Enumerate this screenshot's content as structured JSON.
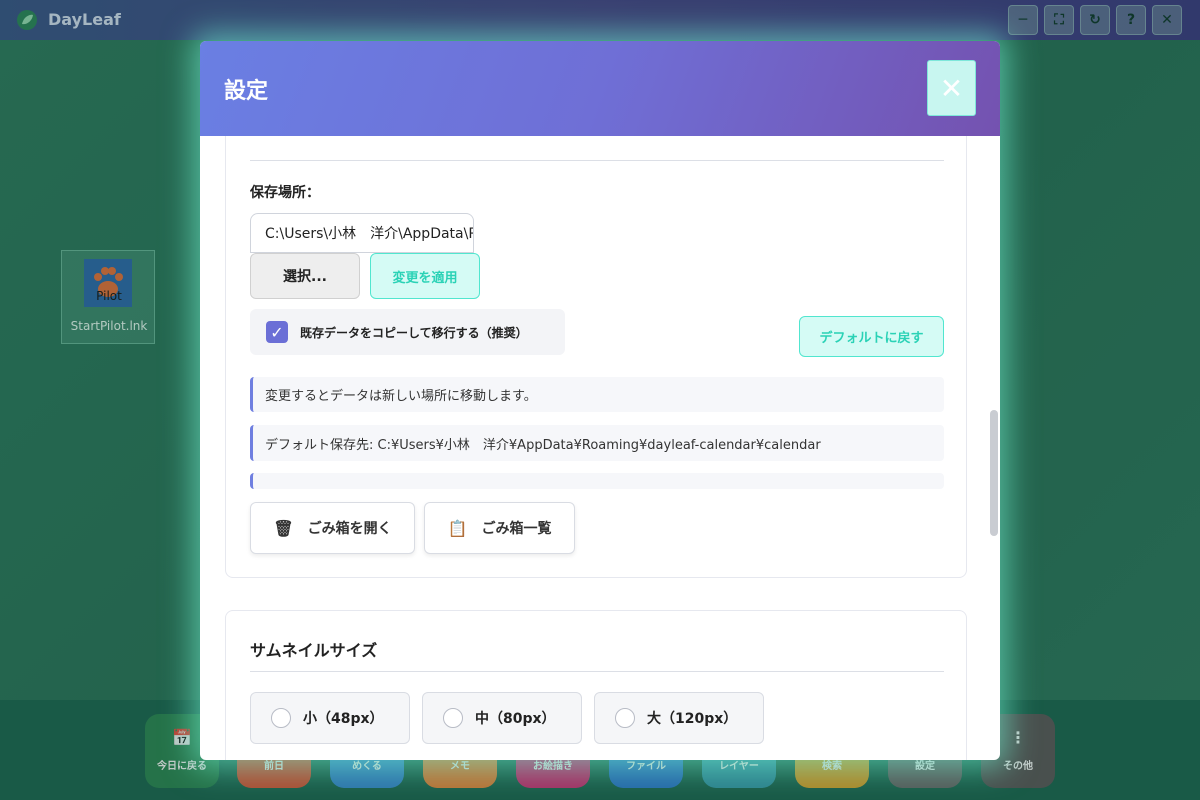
{
  "app": {
    "name": "DayLeaf",
    "window_buttons": [
      "─",
      "⛶",
      "↻",
      "?",
      "✕"
    ]
  },
  "desktop": {
    "shortcut": {
      "image_text": "Pilot",
      "label": "StartPilot.lnk"
    }
  },
  "dock": {
    "items": [
      {
        "label": "今日に戻る",
        "icon": "calendar-icon",
        "glyph": "📅",
        "color": "#2e8b57"
      },
      {
        "label": "前日",
        "icon": "prev-day-icon",
        "glyph": "",
        "color": "#e05a3a"
      },
      {
        "label": "めくる",
        "icon": "flip-icon",
        "glyph": "",
        "color": "#3a8fd8"
      },
      {
        "label": "メモ",
        "icon": "memo-icon",
        "glyph": "",
        "color": "#f08a3c"
      },
      {
        "label": "お絵描き",
        "icon": "draw-icon",
        "glyph": "",
        "color": "#d6337a"
      },
      {
        "label": "ファイル",
        "icon": "file-icon",
        "glyph": "",
        "color": "#2f7fd6"
      },
      {
        "label": "レイヤー",
        "icon": "layer-icon",
        "glyph": "",
        "color": "#39a0b0"
      },
      {
        "label": "検索",
        "icon": "search-icon",
        "glyph": "",
        "color": "#e2a92e"
      },
      {
        "label": "設定",
        "icon": "settings-icon",
        "glyph": "",
        "color": "#6e6e6e"
      },
      {
        "label": "その他",
        "icon": "more-icon",
        "glyph": "⋮",
        "color": "#5e5e5e"
      }
    ]
  },
  "modal": {
    "title": "設定",
    "close_glyph": "✕",
    "data_section": {
      "storage_label": "保存場所：",
      "path_value": "C:\\Users\\小林　洋介\\AppData\\Roaming\\dayleaf-calendar\\calendar",
      "select_button": "選択...",
      "apply_button": "変更を適用",
      "copy_checkbox": {
        "label": "既存データをコピーして移行する（推奨）",
        "checked": true,
        "glyph": "✓"
      },
      "default_button": "デフォルトに戻す",
      "info_move": "変更するとデータは新しい場所に移動します。",
      "info_default": "デフォルト保存先: C:¥Users¥小林　洋介¥AppData¥Roaming¥dayleaf-calendar¥calendar",
      "trash_open_button": {
        "label": "ごみ箱を開く",
        "icon": "trash-icon",
        "glyph": "🗑"
      },
      "trash_list_button": {
        "label": "ごみ箱一覧",
        "icon": "clipboard-icon",
        "glyph": "📋"
      }
    },
    "thumbnail_section": {
      "title": "サムネイルサイズ",
      "options": [
        {
          "label": "小（48px）",
          "selected": false
        },
        {
          "label": "中（80px）",
          "selected": false
        },
        {
          "label": "大（120px）",
          "selected": false
        }
      ]
    }
  }
}
